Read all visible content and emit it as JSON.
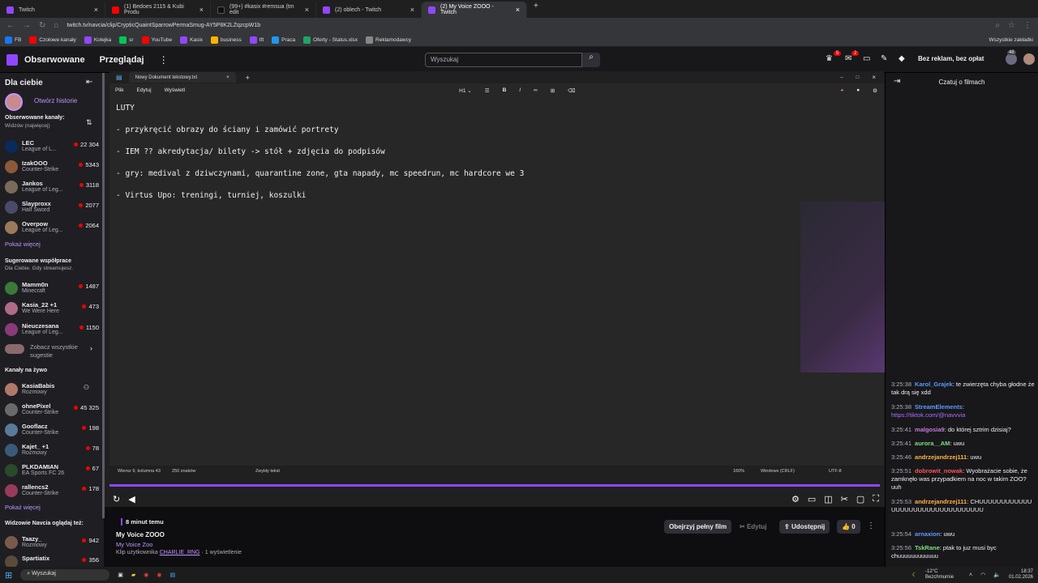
{
  "browser": {
    "tabs": [
      {
        "label": "Twitch",
        "color": "#9147ff"
      },
      {
        "label": "(1) Bedoes 2115 & Kubi Produ",
        "color": "#ff0000"
      },
      {
        "label": "(99+) #kasix #remsua (tm edit",
        "color": "#111111"
      },
      {
        "label": "(2) oblech - Twitch",
        "color": "#9147ff"
      },
      {
        "label": "(2) My Voice ZOOO - Twitch",
        "color": "#9147ff"
      }
    ],
    "url": "twitch.tv/navcia/clip/CrypticQuaintSparrowPermaSmug-AY5P8K2LZqzcpW1b",
    "bookmarks": [
      "FB",
      "Czołowe kanały",
      "Kolejka",
      "sr",
      "YouTube",
      "Kasix",
      "business",
      "tft",
      "Praca",
      "Oferty - Status.xlsx",
      "Reklamodawcy"
    ],
    "bookmarks_right": "Wszystkie zakładki"
  },
  "twitch": {
    "nav_following": "Obserwowane",
    "nav_browse": "Przeglądaj",
    "search_placeholder": "Wyszukaj",
    "notif_count_1": "5",
    "notif_count_2": "2",
    "ad_free": "Bez reklam, bez opłat",
    "badge_48": "48"
  },
  "sidebar": {
    "title": "Dla ciebie",
    "stories": "Otwórz historie",
    "followed_header": "Obserwowane kanały:",
    "followed_sub": "Widzów (najwięcej)",
    "followed": [
      {
        "name": "LEC",
        "game": "League of L...",
        "viewers": "22 304"
      },
      {
        "name": "IzakOOO",
        "game": "Counter-Strike",
        "viewers": "5343"
      },
      {
        "name": "Jankos",
        "game": "League of Leg...",
        "viewers": "3118"
      },
      {
        "name": "Slayproxx",
        "game": "Half Sword",
        "viewers": "2077"
      },
      {
        "name": "Overpow",
        "game": "League of Leg...",
        "viewers": "2064"
      }
    ],
    "show_more": "Pokaż więcej",
    "suggested_header": "Sugerowane współprace",
    "suggested_sub": "Dla Ciebie. Gdy streamujesz.",
    "suggested": [
      {
        "name": "Mamm0n",
        "game": "Minecraft",
        "viewers": "1487"
      },
      {
        "name": "Kasia_22 +1",
        "game": "We Were Here",
        "viewers": "473"
      },
      {
        "name": "Nieuczesana",
        "game": "League of Leg...",
        "viewers": "1150"
      }
    ],
    "see_all": "Zobacz wszystkie sugestie",
    "live_header": "Kanały na żywo",
    "live": [
      {
        "name": "KasiaBabis",
        "game": "Rozmowy",
        "viewers": ""
      },
      {
        "name": "ohnePixel",
        "game": "Counter-Strike",
        "viewers": "45 325"
      },
      {
        "name": "Gooflacz",
        "game": "Counter-Strike",
        "viewers": "198"
      },
      {
        "name": "Kajet_ +1",
        "game": "Rozmowy",
        "viewers": "78"
      },
      {
        "name": "PLKDAMIAN",
        "game": "EA Sports FC 26",
        "viewers": "67"
      },
      {
        "name": "rallencs2",
        "game": "Counter-Strike",
        "viewers": "178"
      }
    ],
    "show_more_2": "Pokaż więcej",
    "also_watch_header": "Widzowie Navcia oglądaj też:",
    "also_watch": [
      {
        "name": "Taazy_",
        "game": "Rozmowy",
        "viewers": "942"
      },
      {
        "name": "Spartiatix",
        "game": "",
        "viewers": "356"
      }
    ]
  },
  "notepad": {
    "tab_title": "Nowy Dokument tekstowy.txt",
    "menu": [
      "Plik",
      "Edytuj",
      "Wyświetl"
    ],
    "heading": "H1",
    "lines": [
      "LUTY",
      "- przykręcić obrazy do ściany i zamówić portrety",
      "- IEM ?? akredytacja/ bilety -> stół + zdjęcia do podpisów",
      "- gry: medival z dziwczynami, quarantine zone, gta napady, mc speedrun, mc hardcore we 3",
      "- Virtus Upo: treningi, turniej, koszulki"
    ],
    "status_pos": "Wiersz 9, kolumna 43",
    "status_chars": "250 znaków",
    "status_type": "Zwykły tekst",
    "status_zoom": "160%",
    "status_eol": "Windows (CRLF)",
    "status_enc": "UTF-8"
  },
  "clip": {
    "time_ago": "8 minut temu",
    "title": "My Voice ZOOO",
    "channel": "My Voice Zoo",
    "clipped_by_prefix": "Klip użytkownika",
    "clipped_by": "CHARLIE_RNG",
    "views": "· 1 wyświetlenie",
    "watch_full": "Obejrzyj pełny film",
    "edit": "Edytuj",
    "share": "Udostępnij",
    "likes": "0"
  },
  "chat": {
    "header": "Czatuj o filmach",
    "messages": [
      {
        "ts": "3:25:38",
        "user": "Karol_Grajek",
        "color": "#5b9bff",
        "text": "te zwierzęta chyba głodne że tak drą się xdd"
      },
      {
        "ts": "3:25:38",
        "user": "StreamElements",
        "color": "#5b9bff",
        "text": "https://tiktok.com/@navvvia"
      },
      {
        "ts": "3:25:41",
        "user": "malgosia9",
        "color": "#c678dd",
        "text": "do której sztrim dzisiaj?"
      },
      {
        "ts": "3:25:41",
        "user": "aurora__AM",
        "color": "#7ee07e",
        "text": "uwu"
      },
      {
        "ts": "3:25:46",
        "user": "andrzejandrzej111",
        "color": "#ffb340",
        "text": "uwu"
      },
      {
        "ts": "3:25:51",
        "user": "dobrowit_nowak",
        "color": "#ff5555",
        "text": "Wyobrażacie sobie, że zamknęło was przypadkiem na noc w takim ZOO? uuh"
      },
      {
        "ts": "3:25:53",
        "user": "andrzejandrzej111",
        "color": "#ffb340",
        "text": "CHUUUUUUUUUUUUUUUUUUUUUUUUUUUUUUUUU"
      },
      {
        "ts": "3:25:54",
        "user": "arnaxion",
        "color": "#5b9bff",
        "text": "uwu"
      },
      {
        "ts": "3:25:56",
        "user": "TskRane",
        "color": "#7ee07e",
        "text": "ptak to juz musi byc chuuuuuuuuuuuu"
      }
    ]
  },
  "taskbar": {
    "search": "Wyszukaj",
    "weather": "-12°C Bezchmurnie",
    "time": "18:37",
    "date": "01.02.2026"
  }
}
